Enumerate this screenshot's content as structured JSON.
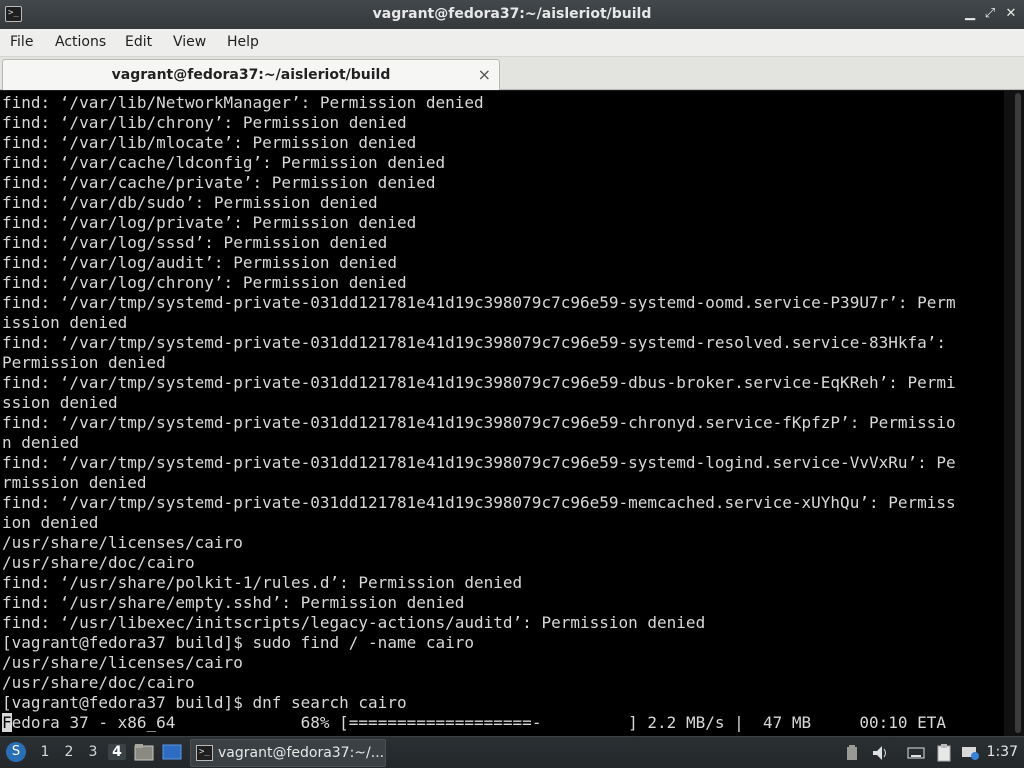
{
  "window": {
    "title": "vagrant@fedora37:~/aisleriot/build",
    "minimize_glyph": "▁",
    "maximize_glyph": "⤢",
    "close_glyph": "✕"
  },
  "menu": [
    "File",
    "Actions",
    "Edit",
    "View",
    "Help"
  ],
  "tab": {
    "label": "vagrant@fedora37:~/aisleriot/build",
    "close_glyph": "×"
  },
  "terminal": {
    "lines": [
      "find: ‘/var/lib/NetworkManager’: Permission denied",
      "find: ‘/var/lib/chrony’: Permission denied",
      "find: ‘/var/lib/mlocate’: Permission denied",
      "find: ‘/var/cache/ldconfig’: Permission denied",
      "find: ‘/var/cache/private’: Permission denied",
      "find: ‘/var/db/sudo’: Permission denied",
      "find: ‘/var/log/private’: Permission denied",
      "find: ‘/var/log/sssd’: Permission denied",
      "find: ‘/var/log/audit’: Permission denied",
      "find: ‘/var/log/chrony’: Permission denied",
      "find: ‘/var/tmp/systemd-private-031dd121781e41d19c398079c7c96e59-systemd-oomd.service-P39U7r’: Perm",
      "ission denied",
      "find: ‘/var/tmp/systemd-private-031dd121781e41d19c398079c7c96e59-systemd-resolved.service-83Hkfa’:",
      "Permission denied",
      "find: ‘/var/tmp/systemd-private-031dd121781e41d19c398079c7c96e59-dbus-broker.service-EqKReh’: Permi",
      "ssion denied",
      "find: ‘/var/tmp/systemd-private-031dd121781e41d19c398079c7c96e59-chronyd.service-fKpfzP’: Permissio",
      "n denied",
      "find: ‘/var/tmp/systemd-private-031dd121781e41d19c398079c7c96e59-systemd-logind.service-VvVxRu’: Pe",
      "rmission denied",
      "find: ‘/var/tmp/systemd-private-031dd121781e41d19c398079c7c96e59-memcached.service-xUYhQu’: Permiss",
      "ion denied",
      "/usr/share/licenses/cairo",
      "/usr/share/doc/cairo",
      "find: ‘/usr/share/polkit-1/rules.d’: Permission denied",
      "find: ‘/usr/share/empty.sshd’: Permission denied",
      "find: ‘/usr/libexec/initscripts/legacy-actions/auditd’: Permission denied",
      "[vagrant@fedora37 build]$ sudo find / -name cairo",
      "/usr/share/licenses/cairo",
      "/usr/share/doc/cairo",
      "[vagrant@fedora37 build]$ dnf search cairo"
    ],
    "progress_cursor_char": "F",
    "progress_rest": "edora 37 - x86_64             68% [===================-         ] 2.2 MB/s |  47 MB     00:10 ETA",
    "progress_percent": 68
  },
  "taskbar": {
    "workspaces": [
      "1",
      "2",
      "3",
      "4"
    ],
    "active_workspace": "4",
    "task_label": "vagrant@fedora37:~/...",
    "clock": "1:37",
    "start_glyph": "S"
  }
}
